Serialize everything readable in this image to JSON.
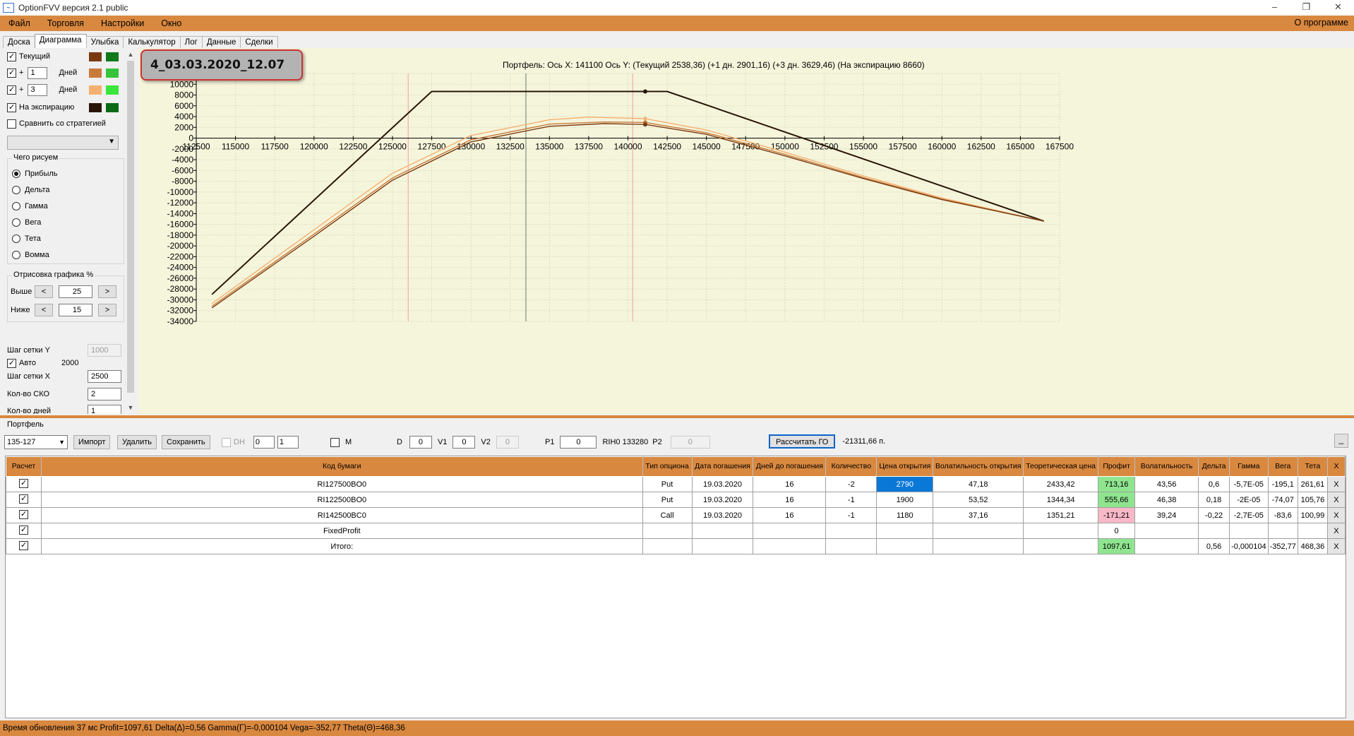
{
  "window": {
    "title": "OptionFVV версия 2.1 public",
    "icon": "chart-icon"
  },
  "menu": {
    "items": [
      "Файл",
      "Торговля",
      "Настройки",
      "Окно"
    ],
    "about": "О программе"
  },
  "tabs": [
    "Доска",
    "Диаграмма",
    "Улыбка",
    "Калькулятор",
    "Лог",
    "Данные",
    "Сделки"
  ],
  "left": {
    "current_label": "Текущий",
    "plus": "+",
    "days_label": "Дней",
    "day1": "1",
    "day2": "3",
    "expiry_label": "На экспирацию",
    "compare_label": "Сравнить со стратегией",
    "what_title": "Чего рисуем",
    "radios": [
      "Прибыль",
      "Дельта",
      "Гамма",
      "Вега",
      "Тета",
      "Вомма"
    ],
    "draw_title": "Отрисовка графика %",
    "above_label": "Выше",
    "above_val": "25",
    "below_label": "Ниже",
    "below_val": "15",
    "lt": "<",
    "gt": ">",
    "gridY_label": "Шаг сетки Y",
    "gridY_val": "1000",
    "auto_label": "Авто",
    "auto_val": "2000",
    "gridX_label": "Шаг сетки X",
    "gridX_val": "2500",
    "sko_label": "Кол-во СКО",
    "sko_val": "2",
    "days_count_label": "Кол-во дней",
    "days_count_val": "1"
  },
  "colors": {
    "current_a": "#7a3a10",
    "current_b": "#0f7a1a",
    "d1_a": "#c87a3a",
    "d1_b": "#36c43a",
    "d3_a": "#f5b070",
    "d3_b": "#3ae63a",
    "exp_a": "#2a1608",
    "exp_b": "#0d6a16"
  },
  "badge": "4_03.03.2020_12.07",
  "chart_title": "Портфель: Ось X: 141100 Ось Y:  (Текущий 2538,36)  (+1 дн. 2901,16)  (+3 дн. 3629,46)  (На экспирацию 8660)",
  "chart_data": {
    "type": "line",
    "x_ticks": [
      112500,
      115000,
      117500,
      120000,
      122500,
      125000,
      127500,
      130000,
      132500,
      135000,
      137500,
      140000,
      142500,
      145000,
      147500,
      150000,
      152500,
      155000,
      157500,
      160000,
      162500,
      165000,
      167500
    ],
    "y_ticks": [
      12000,
      10000,
      8000,
      6000,
      4000,
      2000,
      0,
      -2000,
      -4000,
      -6000,
      -8000,
      -10000,
      -12000,
      -14000,
      -16000,
      -18000,
      -20000,
      -22000,
      -24000,
      -26000,
      -28000,
      -30000,
      -32000,
      -34000
    ],
    "xlim": [
      112500,
      167500
    ],
    "ylim": [
      -34000,
      12000
    ],
    "grid": true,
    "cursor_x": 141100,
    "vlines": [
      126000,
      133500,
      140300
    ],
    "series": [
      {
        "name": "На экспирацию",
        "color": "#2a1608",
        "points": [
          [
            113500,
            -29000
          ],
          [
            127500,
            8660
          ],
          [
            142500,
            8660
          ],
          [
            166500,
            -15400
          ]
        ]
      },
      {
        "name": "+3 дн.",
        "color": "#f5b070",
        "points": [
          [
            113500,
            -30700
          ],
          [
            120000,
            -17000
          ],
          [
            125000,
            -6500
          ],
          [
            130000,
            500
          ],
          [
            135000,
            3400
          ],
          [
            137500,
            3900
          ],
          [
            141100,
            3629
          ],
          [
            145000,
            1500
          ],
          [
            150000,
            -2600
          ],
          [
            155000,
            -7000
          ],
          [
            160000,
            -11100
          ],
          [
            166500,
            -15400
          ]
        ]
      },
      {
        "name": "+1 дн.",
        "color": "#c87a3a",
        "points": [
          [
            113500,
            -31200
          ],
          [
            120000,
            -17800
          ],
          [
            125000,
            -7400
          ],
          [
            130000,
            -300
          ],
          [
            135000,
            2600
          ],
          [
            138500,
            3000
          ],
          [
            141100,
            2901
          ],
          [
            145000,
            1000
          ],
          [
            150000,
            -3000
          ],
          [
            155000,
            -7300
          ],
          [
            160000,
            -11300
          ],
          [
            166500,
            -15400
          ]
        ]
      },
      {
        "name": "Текущий",
        "color": "#7a3a10",
        "points": [
          [
            113500,
            -31500
          ],
          [
            120000,
            -18200
          ],
          [
            125000,
            -7800
          ],
          [
            130000,
            -700
          ],
          [
            135000,
            2200
          ],
          [
            138500,
            2700
          ],
          [
            141100,
            2538
          ],
          [
            145000,
            700
          ],
          [
            150000,
            -3300
          ],
          [
            155000,
            -7500
          ],
          [
            160000,
            -11400
          ],
          [
            166500,
            -15400
          ]
        ]
      }
    ]
  },
  "portfolio": {
    "label": "Портфель",
    "selected": "135-127",
    "import": "Импорт",
    "delete": "Удалить",
    "save": "Сохранить",
    "dh": "DH",
    "dh_a": "0",
    "dh_b": "1",
    "m": "M",
    "d_label": "D",
    "d_val": "0",
    "v1_label": "V1",
    "v1_val": "0",
    "v2_label": "V2",
    "v2_val": "0",
    "p1_label": "P1",
    "p1_val": "0",
    "rih": "RIH0 133280",
    "p2_label": "P2",
    "p2_val": "0",
    "calc_go": "Рассчитать ГО",
    "go_val": "-21311,66 п.",
    "collapse": "_"
  },
  "table": {
    "headers": [
      "Расчет",
      "Код бумаги",
      "Тип опциона",
      "Дата погашения",
      "Дней до погашения",
      "Количество",
      "Цена открытия",
      "Волатильность открытия",
      "Теоретическая цена",
      "Профит",
      "Волатильность",
      "Дельта",
      "Гамма",
      "Вега",
      "Тета",
      "X"
    ],
    "rows": [
      [
        "",
        "RI127500BO0",
        "Put",
        "19.03.2020",
        "16",
        "-2",
        "2790",
        "47,18",
        "2433,42",
        "713,16",
        "43,56",
        "0,6",
        "-5,7E-05",
        "-195,1",
        "261,61",
        "X"
      ],
      [
        "",
        "RI122500BO0",
        "Put",
        "19.03.2020",
        "16",
        "-1",
        "1900",
        "53,52",
        "1344,34",
        "555,66",
        "46,38",
        "0,18",
        "-2E-05",
        "-74,07",
        "105,76",
        "X"
      ],
      [
        "",
        "RI142500BC0",
        "Call",
        "19.03.2020",
        "16",
        "-1",
        "1180",
        "37,16",
        "1351,21",
        "-171,21",
        "39,24",
        "-0,22",
        "-2,7E-05",
        "-83,6",
        "100,99",
        "X"
      ],
      [
        "",
        "FixedProfit",
        "",
        "",
        "",
        "",
        "",
        "",
        "",
        "0",
        "",
        "",
        "",
        "",
        "",
        "X"
      ],
      [
        "",
        "Итого:",
        "",
        "",
        "",
        "",
        "",
        "",
        "",
        "1097,61",
        "",
        "0,56",
        "-0,000104",
        "-352,77",
        "468,36",
        "X"
      ]
    ]
  },
  "status": "Время обновления 37 мс  Profit=1097,61 Delta(Δ)=0,56 Gamma(Γ)=-0,000104 Vega=-352,77 Theta(Θ)=468,36"
}
